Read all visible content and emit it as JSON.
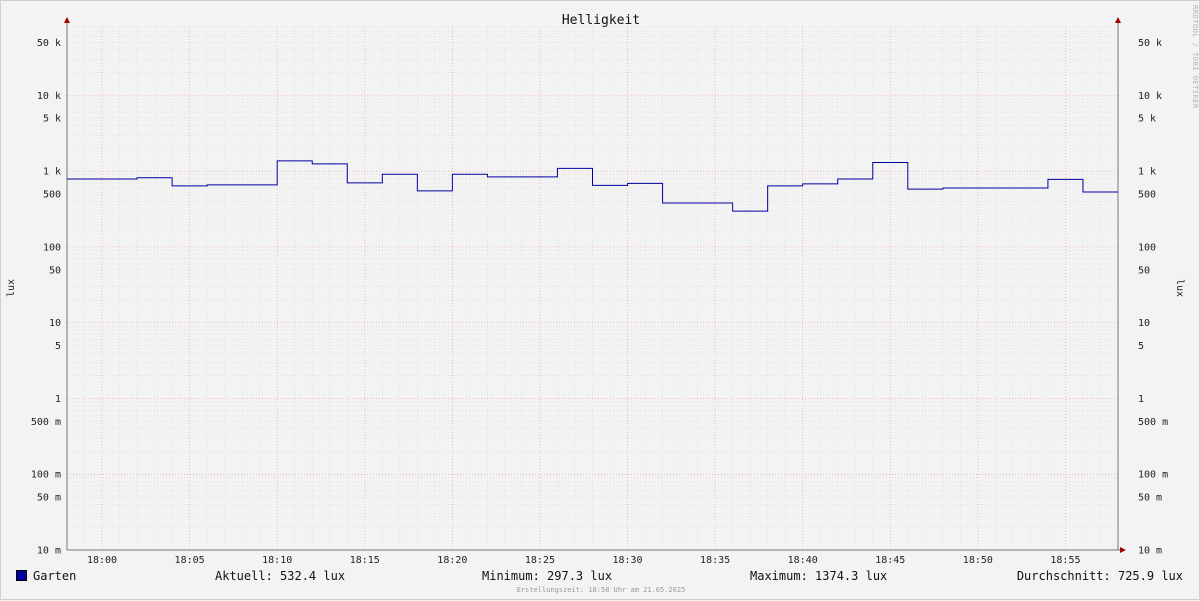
{
  "chart_data": {
    "type": "line",
    "title": "Helligkeit",
    "ylabel": "lux",
    "yscale": "log",
    "ylim": [
      0.01,
      80000
    ],
    "y_ticks": [
      {
        "value": 50000,
        "label": "50 k"
      },
      {
        "value": 10000,
        "label": "10 k"
      },
      {
        "value": 5000,
        "label": "5 k"
      },
      {
        "value": 1000,
        "label": "1 k"
      },
      {
        "value": 500,
        "label": "500"
      },
      {
        "value": 100,
        "label": "100"
      },
      {
        "value": 50,
        "label": "50"
      },
      {
        "value": 10,
        "label": "10"
      },
      {
        "value": 5,
        "label": "5"
      },
      {
        "value": 1,
        "label": "1"
      },
      {
        "value": 0.5,
        "label": "500 m"
      },
      {
        "value": 0.1,
        "label": "100 m"
      },
      {
        "value": 0.05,
        "label": "50 m"
      },
      {
        "value": 0.01,
        "label": "10 m"
      }
    ],
    "x_ticks": [
      "18:00",
      "18:05",
      "18:10",
      "18:15",
      "18:20",
      "18:25",
      "18:30",
      "18:35",
      "18:40",
      "18:45",
      "18:50",
      "18:55"
    ],
    "xlim": [
      "17:58",
      "17:58 +60min"
    ],
    "grid": true,
    "series": [
      {
        "name": "Garten",
        "color": "#0000a0",
        "step": true,
        "x": [
          "17:58",
          "18:00",
          "18:02",
          "18:04",
          "18:06",
          "18:08",
          "18:10",
          "18:12",
          "18:14",
          "18:16",
          "18:18",
          "18:20",
          "18:22",
          "18:24",
          "18:26",
          "18:28",
          "18:30",
          "18:32",
          "18:34",
          "18:36",
          "18:38",
          "18:40",
          "18:42",
          "18:44",
          "18:46",
          "18:48",
          "18:50",
          "18:52",
          "18:54",
          "18:56",
          "18:58"
        ],
        "values": [
          790,
          790,
          820,
          640,
          660,
          660,
          1370,
          1250,
          700,
          910,
          550,
          910,
          840,
          840,
          1090,
          650,
          690,
          380,
          380,
          297,
          640,
          680,
          790,
          1300,
          580,
          600,
          600,
          600,
          780,
          532,
          532
        ]
      }
    ]
  },
  "legend": {
    "series_name": "Garten",
    "current": "Aktuell: 532.4 lux",
    "minimum": "Minimum: 297.3 lux",
    "maximum": "Maximum: 1374.3 lux",
    "average": "Durchschnitt: 725.9 lux"
  },
  "footer_note": "Erstellungszeit: 18:58 Uhr am 21.05.2025",
  "watermark": "RRDTOOL / TOBI OETIKER"
}
